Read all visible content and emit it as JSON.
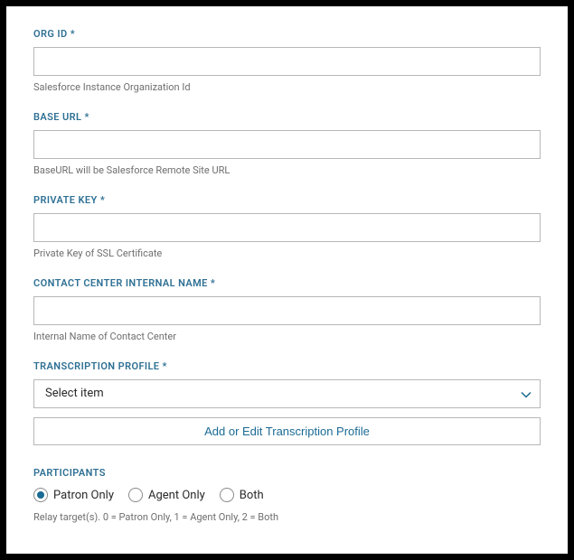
{
  "fields": {
    "org_id": {
      "label": "ORG ID",
      "required": "*",
      "value": "",
      "help": "Salesforce Instance Organization Id"
    },
    "base_url": {
      "label": "BASE URL",
      "required": "*",
      "value": "",
      "help": "BaseURL will be Salesforce Remote Site URL"
    },
    "private_key": {
      "label": "PRIVATE KEY",
      "required": "*",
      "value": "",
      "help": "Private Key of SSL Certificate"
    },
    "contact_center": {
      "label": "CONTACT CENTER INTERNAL NAME",
      "required": "*",
      "value": "",
      "help": "Internal Name of Contact Center"
    },
    "transcription_profile": {
      "label": "TRANSCRIPTION PROFILE",
      "required": "*",
      "selected": "Select item",
      "button": "Add or Edit Transcription Profile"
    }
  },
  "participants": {
    "label": "PARTICIPANTS",
    "options": {
      "patron": "Patron Only",
      "agent": "Agent Only",
      "both": "Both"
    },
    "selected": "patron",
    "help": "Relay target(s). 0 = Patron Only, 1 = Agent Only, 2 = Both"
  }
}
